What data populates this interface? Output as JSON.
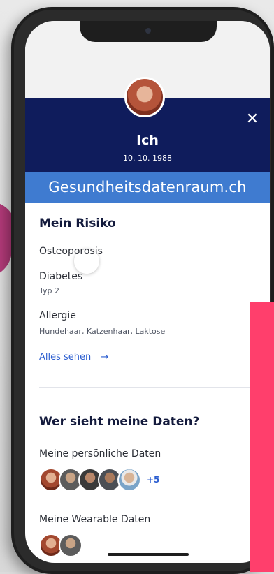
{
  "profile": {
    "name": "Ich",
    "birth_date": "10. 10. 1988"
  },
  "brand": "Gesundheitsdatenraum.ch",
  "risk_section": {
    "title": "Mein Risiko",
    "items": [
      {
        "label": "Osteoporosis",
        "detail": ""
      },
      {
        "label": "Diabetes",
        "detail": "Typ 2"
      },
      {
        "label": "Allergie",
        "detail": "Hundehaar, Katzenhaar, Laktose"
      }
    ],
    "see_all": "Alles sehen",
    "see_all_arrow": "→"
  },
  "sharing_section": {
    "title": "Wer sieht meine Daten?",
    "personal_label": "Meine persönliche Daten",
    "personal_extra": "+5",
    "wearable_label": "Meine Wearable Daten"
  },
  "icons": {
    "close": "close-icon",
    "settings": "gear-icon",
    "arrow": "arrow-right-icon"
  },
  "colors": {
    "header": "#0f1c5c",
    "brand_bar": "#3f7bd0",
    "link": "#2d5fd0",
    "pink_panel": "#ff3f6c"
  }
}
